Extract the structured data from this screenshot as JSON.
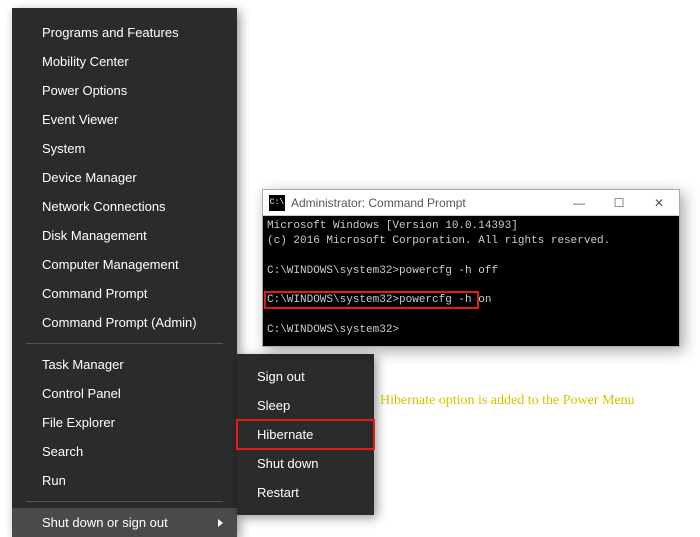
{
  "winx": {
    "group1": [
      "Programs and Features",
      "Mobility Center",
      "Power Options",
      "Event Viewer",
      "System",
      "Device Manager",
      "Network Connections",
      "Disk Management",
      "Computer Management",
      "Command Prompt",
      "Command Prompt (Admin)"
    ],
    "group2": [
      "Task Manager",
      "Control Panel",
      "File Explorer",
      "Search",
      "Run"
    ],
    "active": "Shut down or sign out"
  },
  "submenu": {
    "items": [
      "Sign out",
      "Sleep",
      "Hibernate",
      "Shut down",
      "Restart"
    ],
    "highlight_index": 2
  },
  "cmd": {
    "title": "Administrator: Command Prompt",
    "icon_text": "C:\\",
    "lines": [
      "Microsoft Windows [Version 10.0.14393]",
      "(c) 2016 Microsoft Corporation. All rights reserved.",
      "",
      "C:\\WINDOWS\\system32>powercfg -h off",
      "",
      "C:\\WINDOWS\\system32>powercfg -h on",
      "",
      "C:\\WINDOWS\\system32>"
    ],
    "highlight_line_index": 5,
    "win_buttons": {
      "min": "—",
      "max": "☐",
      "close": "✕"
    }
  },
  "annotation": "Hibernate option is added to the Power Menu"
}
